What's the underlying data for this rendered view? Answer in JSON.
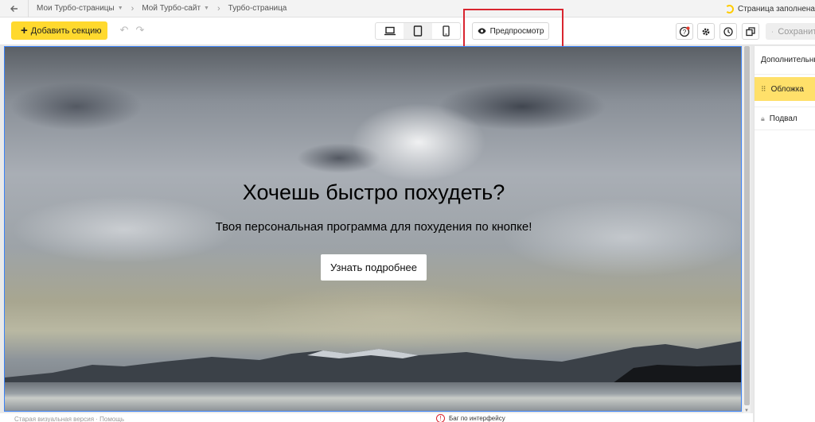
{
  "breadcrumbs": [
    {
      "label": "Мои Турбо-страницы"
    },
    {
      "label": "Мой Турбо-сайт"
    },
    {
      "label": "Турбо-страница"
    }
  ],
  "status": {
    "text": "Страница заполнена"
  },
  "toolbar": {
    "add_section_label": "Добавить секцию",
    "preview_label": "Предпросмотр",
    "save_label": "Сохранить"
  },
  "hero": {
    "title": "Хочешь быстро похудеть?",
    "subtitle": "Твоя персональная программа для похудения по кнопке!",
    "button_label": "Узнать подробнее"
  },
  "panel": {
    "header": "Дополнительные",
    "items": [
      {
        "label": "Обложка",
        "active": true
      },
      {
        "label": "Подвал",
        "locked": true
      }
    ]
  },
  "footer": {
    "left_text": "Старая визуальная версия · Помощь",
    "feedback_text": "Баг по интерфейсу"
  },
  "colors": {
    "accent": "#ffd92e",
    "highlight_frame": "#d9252f",
    "selection_border": "#3a82f7"
  }
}
